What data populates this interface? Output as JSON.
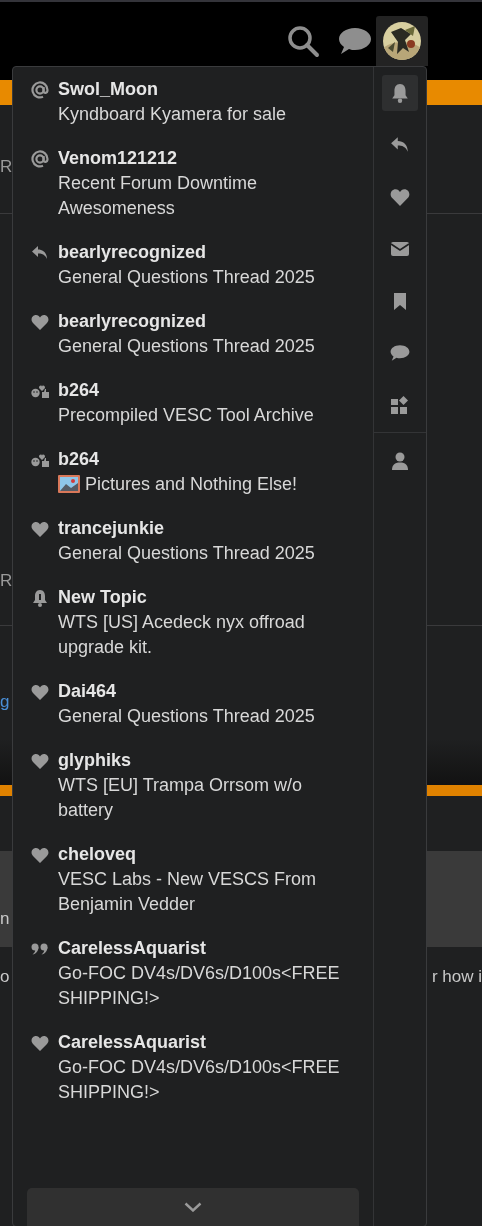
{
  "page_behind": [
    {
      "left": "R"
    },
    {
      "left": "R"
    },
    {
      "left": "g"
    },
    {
      "left": "n"
    },
    {
      "left": "o",
      "right": "r how i"
    }
  ],
  "notifications": [
    {
      "kind": "mention",
      "user": "Swol_Moon",
      "topic": "Kyndboard Kyamera for sale"
    },
    {
      "kind": "mention",
      "user": "Venom121212",
      "topic": "Recent Forum Downtime Awesomeness"
    },
    {
      "kind": "reply",
      "user": "bearlyrecognized",
      "topic": "General Questions Thread 2025"
    },
    {
      "kind": "like",
      "user": "bearlyrecognized",
      "topic": "General Questions Thread 2025"
    },
    {
      "kind": "reaction",
      "user": "b264",
      "topic": "Precompiled VESC Tool Archive"
    },
    {
      "kind": "reaction",
      "user": "b264",
      "topic": "Pictures and Nothing Else!",
      "picture_emoji": true
    },
    {
      "kind": "like",
      "user": "trancejunkie",
      "topic": "General Questions Thread 2025"
    },
    {
      "kind": "new_topic",
      "user": "New Topic",
      "topic": "WTS [US] Acedeck nyx offroad upgrade kit."
    },
    {
      "kind": "like",
      "user": "Dai464",
      "topic": "General Questions Thread 2025"
    },
    {
      "kind": "like",
      "user": "glyphiks",
      "topic": "WTS [EU] Trampa Orrsom w/o battery"
    },
    {
      "kind": "like",
      "user": "cheloveq",
      "topic": "VESC Labs - New VESCS From Benjamin Vedder"
    },
    {
      "kind": "quote",
      "user": "CarelessAquarist",
      "topic": "Go-FOC DV4s/DV6s/D100s<FREE SHIPPING!>"
    },
    {
      "kind": "like",
      "user": "CarelessAquarist",
      "topic": "Go-FOC DV4s/DV6s/D100s<FREE SHIPPING!>"
    }
  ],
  "side_tabs": [
    {
      "kind": "bell",
      "selected": true
    },
    {
      "kind": "reply",
      "selected": false
    },
    {
      "kind": "heart",
      "selected": false
    },
    {
      "kind": "envelope",
      "selected": false
    },
    {
      "kind": "bookmark",
      "selected": false
    },
    {
      "kind": "chat",
      "selected": false
    },
    {
      "kind": "widgets",
      "selected": false
    },
    {
      "kind": "user",
      "selected": false
    }
  ]
}
